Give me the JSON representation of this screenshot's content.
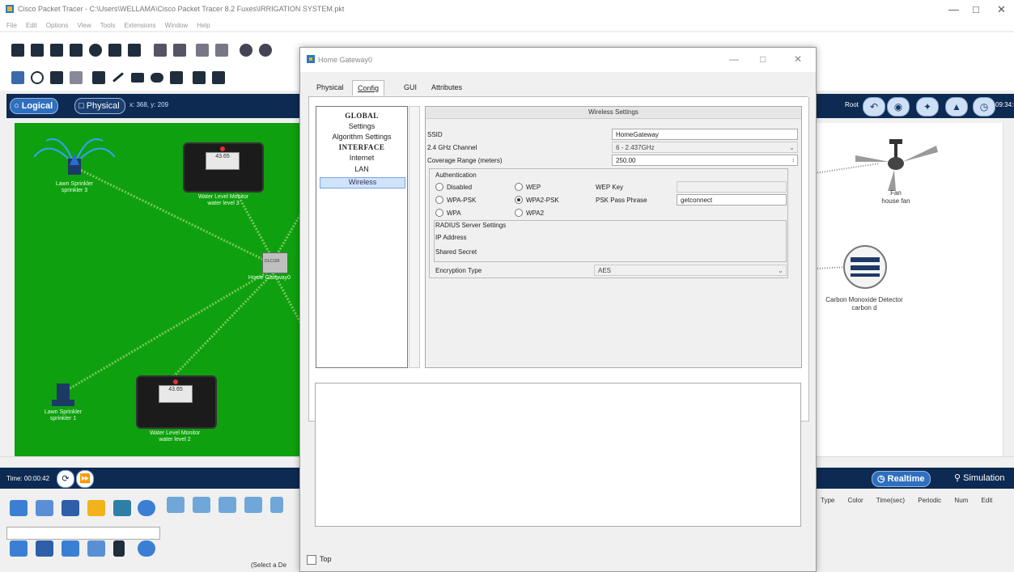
{
  "window": {
    "title": "Cisco Packet Tracer - C:\\Users\\WELLAMA\\Cisco Packet Tracer 8.2 Fuxes\\IRRIGATION SYSTEM.pkt",
    "minimize": "—",
    "maximize": "□",
    "close": "✕"
  },
  "menu": [
    "File",
    "Edit",
    "Options",
    "View",
    "Tools",
    "Extensions",
    "Window",
    "Help"
  ],
  "toolbar": {
    "help": "?"
  },
  "logical_bar": {
    "logical": "Logical",
    "physical": "Physical",
    "coords": "x: 368, y: 209",
    "root": "Root",
    "clock": "09:34:30"
  },
  "workspace": {
    "devices": [
      {
        "name": "Lawn Sprinkler\nsprinkler 3"
      },
      {
        "name": "Water Level Monitor\nwater level 3",
        "screen": "43.65"
      },
      {
        "name": "Home Gateway0",
        "code": "DLC100"
      },
      {
        "name": "Lawn Sprinkler\nsprinkler 1"
      },
      {
        "name": "Water Level Monitor\nwater level 2",
        "screen": "43.65"
      }
    ],
    "right_devices": [
      {
        "name": "Fan\nhouse fan"
      },
      {
        "name": "Carbon Monoxide Detector\ncarbon d"
      }
    ]
  },
  "time_bar": {
    "time": "Time: 00:00:42"
  },
  "realtime": {
    "realtime": "Realtime",
    "simulation": "Simulation"
  },
  "sim_table": {
    "headers": [
      "Type",
      "Color",
      "Time(sec)",
      "Periodic",
      "Num",
      "Edit"
    ]
  },
  "palette": {
    "select_label": "(Select a De"
  },
  "dialog": {
    "title": "Home Gateway0",
    "minimize": "—",
    "maximize": "□",
    "close": "✕",
    "tabs": [
      "Physical",
      "Config",
      "GUI",
      "Attributes"
    ],
    "sidebar": {
      "global": "GLOBAL",
      "settings": "Settings",
      "algorithm": "Algorithm Settings",
      "interface": "INTERFACE",
      "internet": "Internet",
      "lan": "LAN",
      "wireless": "Wireless"
    },
    "panel": {
      "title": "Wireless Settings",
      "ssid_label": "SSID",
      "ssid_value": "HomeGateway",
      "channel_label": "2.4 GHz Channel",
      "channel_value": "6 - 2.437GHz",
      "range_label": "Coverage Range (meters)",
      "range_value": "250.00",
      "auth_label": "Authentication",
      "auth_options": [
        "Disabled",
        "WEP",
        "WPA-PSK",
        "WPA2-PSK",
        "WPA",
        "WPA2"
      ],
      "auth_selected": "WPA2-PSK",
      "wep_key_label": "WEP Key",
      "psk_label": "PSK Pass Phrase",
      "psk_value": "getconnect",
      "radius_label": "RADIUS Server Settings",
      "ip_label": "IP Address",
      "secret_label": "Shared Secret",
      "encryption_label": "Encryption Type",
      "encryption_value": "AES"
    },
    "top_label": "Top"
  }
}
